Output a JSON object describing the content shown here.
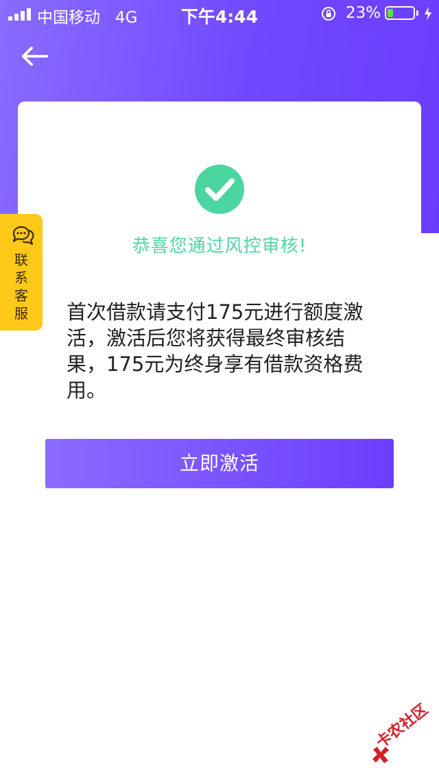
{
  "status_bar": {
    "carrier": "中国移动",
    "network": "4G",
    "time": "下午4:44",
    "battery_percent": "23%",
    "battery_level": 0.23,
    "battery_color": "#5ee04a"
  },
  "nav": {
    "back_icon": "arrow-left-icon"
  },
  "result": {
    "icon": "check-circle-icon",
    "icon_color": "#4cd69f",
    "title": "恭喜您通过风控审核!",
    "description": "首次借款请支付175元进行额度激活，激活后您将获得最终审核结果，175元为终身享有借款资格费用。"
  },
  "action": {
    "activate_label": "立即激活"
  },
  "support": {
    "icon": "chat-bubbles-icon",
    "label_chars": [
      "联",
      "系",
      "客",
      "服"
    ],
    "color": "#ffc91a"
  },
  "watermark": {
    "text": "卡农社区",
    "color": "#d2202a"
  },
  "theme": {
    "primary": "#7148ff",
    "primary_light": "#8a6cff"
  }
}
